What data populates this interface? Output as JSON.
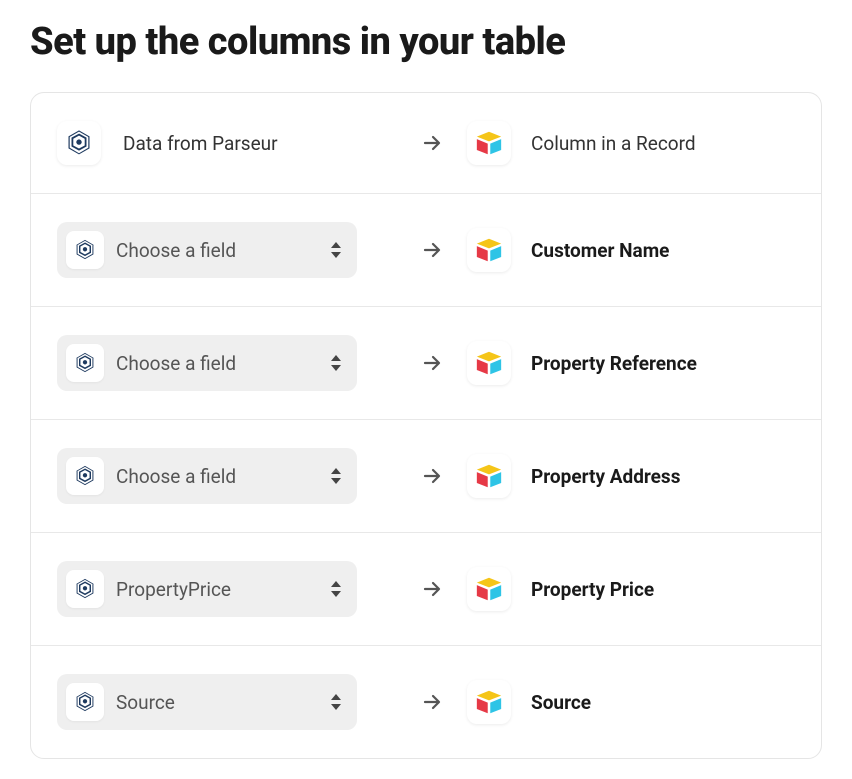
{
  "title": "Set up the columns in your table",
  "header": {
    "source_label": "Data from Parseur",
    "target_label": "Column in a Record"
  },
  "placeholder": "Choose a field",
  "mappings": [
    {
      "source": "Choose a field",
      "target": "Customer Name"
    },
    {
      "source": "Choose a field",
      "target": "Property Reference"
    },
    {
      "source": "Choose a field",
      "target": "Property Address"
    },
    {
      "source": "PropertyPrice",
      "target": "Property Price"
    },
    {
      "source": "Source",
      "target": "Source"
    }
  ]
}
